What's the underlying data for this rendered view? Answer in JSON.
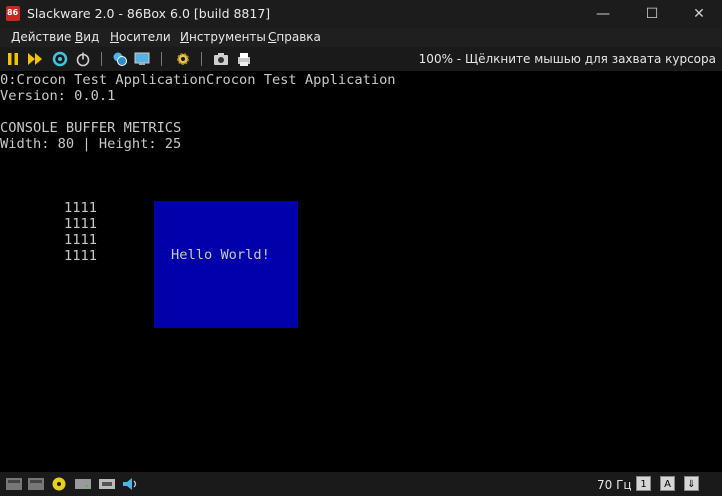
{
  "window": {
    "title": "Slackware 2.0 - 86Box 6.0 [build 8817]",
    "minimize_glyph": "—",
    "maximize_glyph": "☐",
    "close_glyph": "✕"
  },
  "menu": {
    "items": [
      {
        "label": "Действие"
      },
      {
        "label": "Вид"
      },
      {
        "label": "Носители"
      },
      {
        "label": "Инструменты"
      },
      {
        "label": "Справка"
      }
    ]
  },
  "toolbar": {
    "status_text": "100% - Щёлкните мышью для захвата курсора",
    "icons": [
      "pause-icon",
      "fast-forward-icon",
      "reset-icon",
      "power-icon",
      "ctrl-alt-del-icon",
      "settings-icon",
      "screenshot-icon",
      "printer-icon"
    ]
  },
  "screen": {
    "lines": [
      "0:Crocon Test ApplicationCrocon Test Application",
      "Version: 0.0.1",
      "",
      "CONSOLE BUFFER METRICS",
      "Width: 80 | Height: 25"
    ],
    "numbers": [
      "1111",
      "1111",
      "1111",
      "1111"
    ],
    "hello_box": {
      "text": "Hello World!",
      "color": "#0000aa"
    },
    "text_color": "#c8c8c8"
  },
  "statusbar": {
    "refresh_rate": "70 Гц",
    "keys": [
      "1",
      "A",
      "⇓"
    ]
  }
}
